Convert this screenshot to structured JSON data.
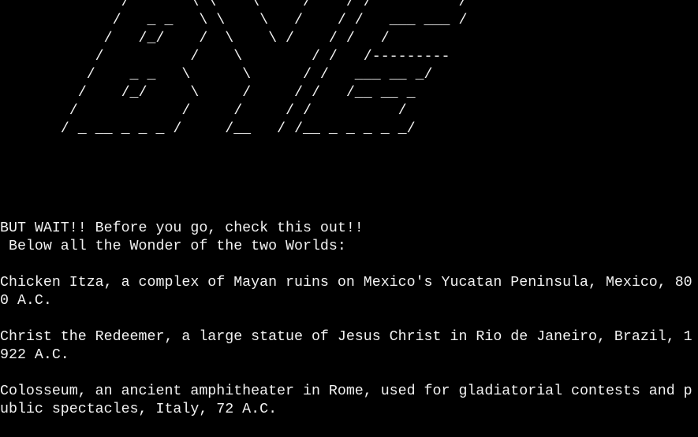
{
  "terminal": {
    "background": "#000000",
    "foreground": "#f2f2f2",
    "banner": "              /       \\ \\    \\     /    / /          /\n             /   _ _   \\ \\    \\   /    / /   ___ ___ /\n            /   /_/    /  \\    \\ /    / /   /\n           /          /    \\        / /   /---------\n          /    _ _   \\      \\      / /   ___ __ _/\n         /    /_/     \\     /     / /   /__ __ _\n        /            /     /     / /          /\n       / _ __ _ _ _ /     /__   / /__ _ _ _ _ _/",
    "lines": [
      "BUT WAIT!! Before you go, check this out!!",
      " Below all the Wonder of the two Worlds:",
      "",
      "Chicken Itza, a complex of Mayan ruins on Mexico's Yucatan Peninsula, Mexico, 80",
      "0 A.C.",
      "",
      "Christ the Redeemer, a large statue of Jesus Christ in Rio de Janeiro, Brazil, 1",
      "922 A.C.",
      "",
      "Colosseum, an ancient amphitheater in Rome, used for gladiatorial contests and p",
      "ublic spectacles, Italy, 72 A.C."
    ]
  }
}
